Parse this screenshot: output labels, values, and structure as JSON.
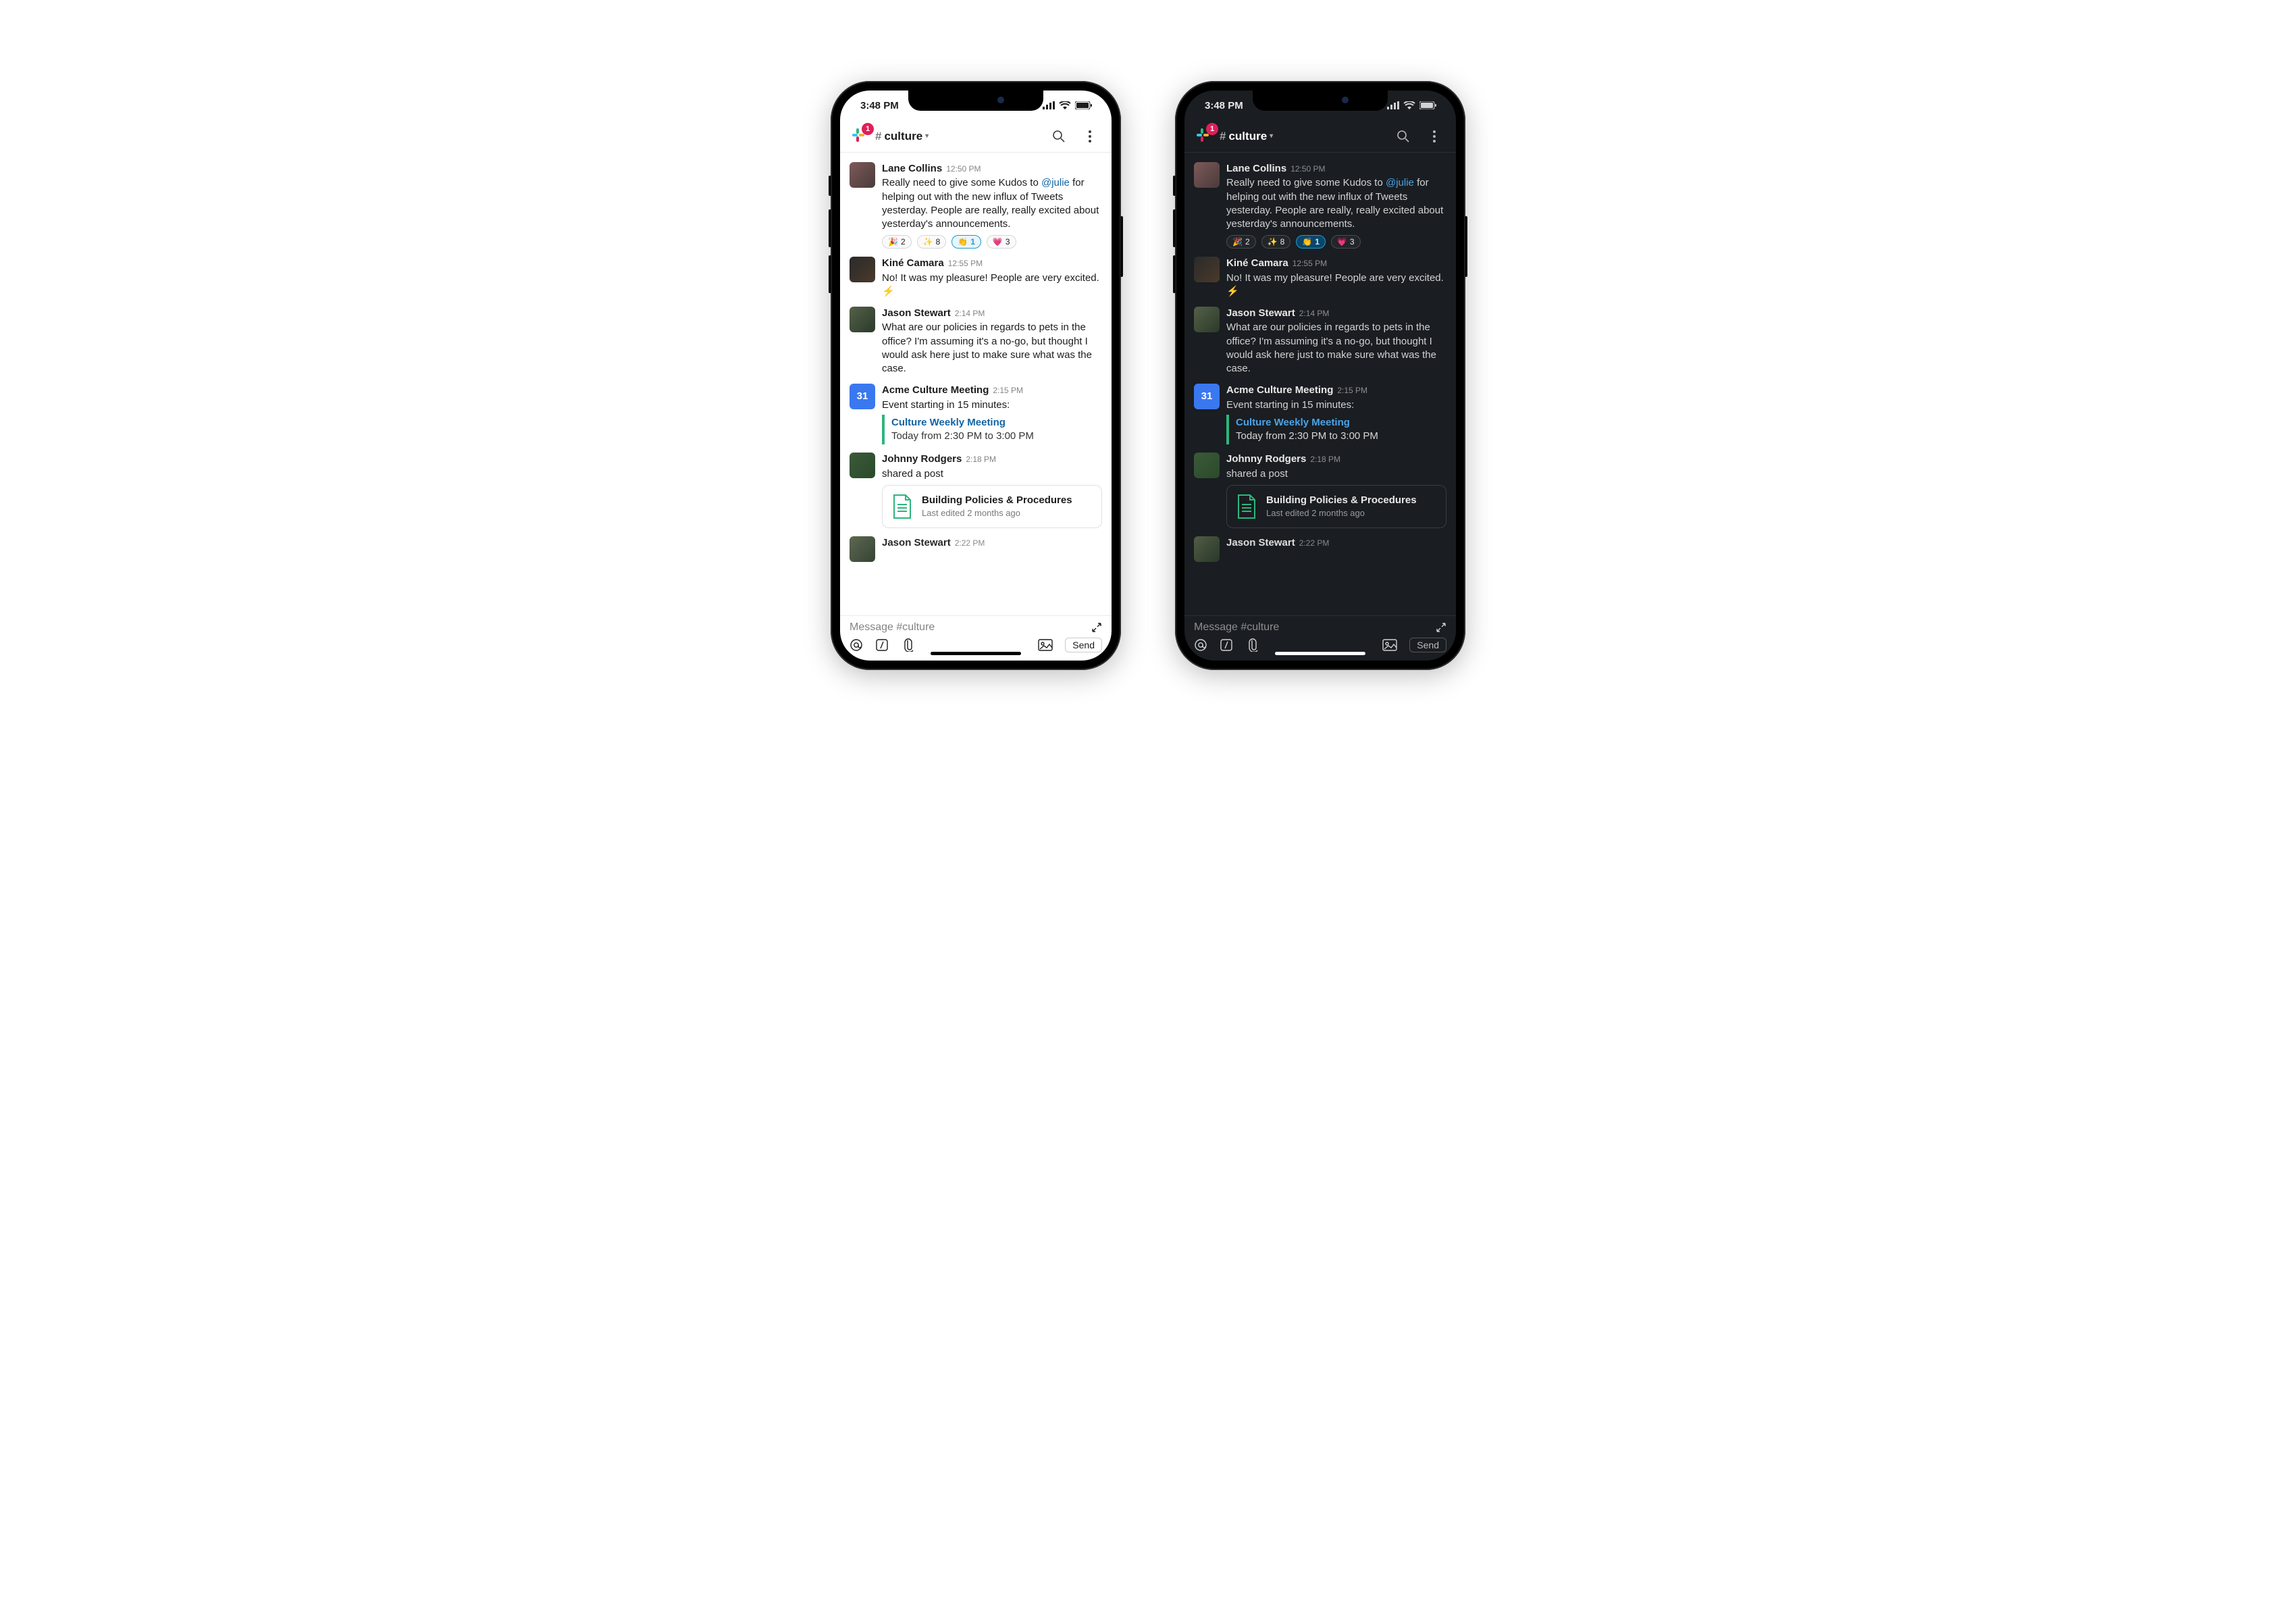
{
  "statusbar": {
    "time": "3:48 PM"
  },
  "header": {
    "badge": "1",
    "channel_hash": "#",
    "channel_name": "culture"
  },
  "messages": [
    {
      "author": "Lane Collins",
      "ts": "12:50 PM",
      "text_pre": "Really need to give some Kudos to ",
      "mention": "@julie",
      "text_post": " for helping out with the new influx of Tweets yesterday. People are really, really excited about yesterday's announcements.",
      "reactions": [
        {
          "emoji": "🎉",
          "count": "2",
          "selected": false
        },
        {
          "emoji": "✨",
          "count": "8",
          "selected": false
        },
        {
          "emoji": "👏",
          "count": "1",
          "selected": true
        },
        {
          "emoji": "💗",
          "count": "3",
          "selected": false
        }
      ]
    },
    {
      "author": "Kiné Camara",
      "ts": "12:55 PM",
      "text": "No! It was my pleasure! People are very excited.  ⚡"
    },
    {
      "author": "Jason Stewart",
      "ts": "2:14 PM",
      "text": "What are our policies in regards to pets in the office? I'm assuming it's a no-go, but thought I would ask here just to make sure what was the case."
    },
    {
      "author": "Acme Culture Meeting",
      "ts": "2:15 PM",
      "cal_day": "31",
      "text": "Event starting in 15 minutes:",
      "event_title": "Culture Weekly Meeting",
      "event_time": "Today from 2:30 PM to 3:00 PM"
    },
    {
      "author": "Johnny Rodgers",
      "ts": "2:18 PM",
      "text": "shared a post",
      "post_title": "Building Policies & Procedures",
      "post_sub": "Last edited 2 months ago"
    },
    {
      "author": "Jason Stewart",
      "ts": "2:22 PM"
    }
  ],
  "composer": {
    "placeholder": "Message #culture",
    "send": "Send"
  }
}
